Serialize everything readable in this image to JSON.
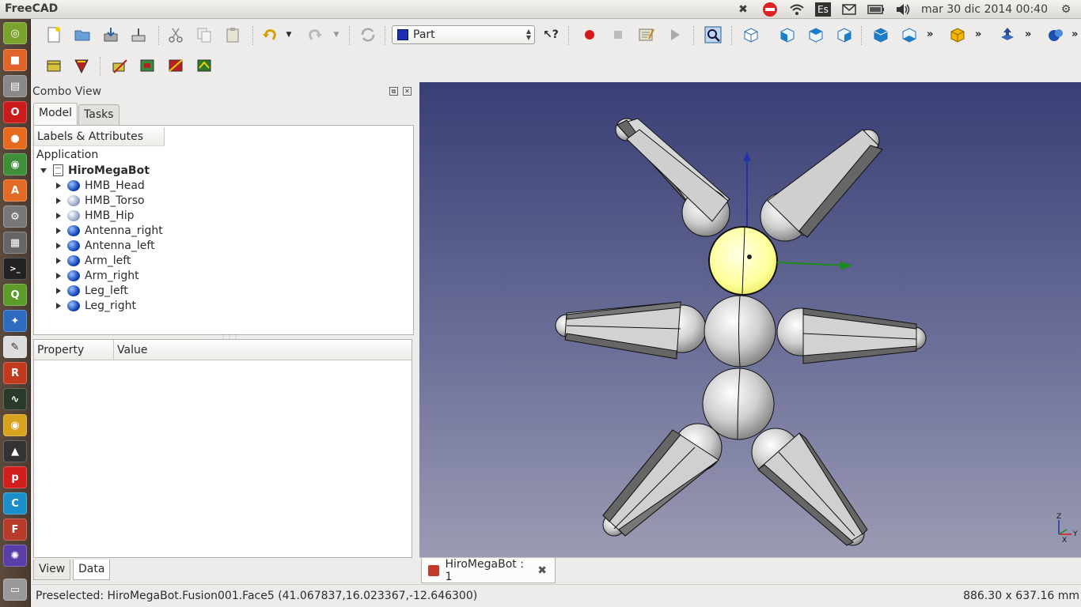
{
  "topbar": {
    "app_name": "FreeCAD",
    "clock": "mar 30 dic 2014 00:40",
    "keyboard_layout": "Es",
    "indicators": [
      "dropbox-icon",
      "stop-sign-icon",
      "wifi-icon",
      "keyboard-layout-icon",
      "mail-icon",
      "battery-icon",
      "volume-icon",
      "gear-icon"
    ]
  },
  "launcher": {
    "items": [
      "dash-home",
      "files",
      "file-manager",
      "opera",
      "firefox",
      "chrome",
      "software-center",
      "system-settings",
      "calculator",
      "terminal",
      "qgis",
      "inkscape-like",
      "text-editor",
      "r-app",
      "system-monitor",
      "blender",
      "inkscape",
      "p-app",
      "c-app",
      "freecad",
      "gnome-app",
      "trash"
    ]
  },
  "toolbar": {
    "workbench": "Part"
  },
  "combo_view": {
    "title": "Combo View",
    "tabs": [
      {
        "label": "Model",
        "active": true
      },
      {
        "label": "Tasks",
        "active": false
      }
    ],
    "tree_header": "Labels & Attributes",
    "tree_root": "Application",
    "document": "HiroMegaBot",
    "items": [
      {
        "label": "HMB_Head",
        "visible": true
      },
      {
        "label": "HMB_Torso",
        "visible": false
      },
      {
        "label": "HMB_Hip",
        "visible": false
      },
      {
        "label": "Antenna_right",
        "visible": true
      },
      {
        "label": "Antenna_left",
        "visible": true
      },
      {
        "label": "Arm_left",
        "visible": true
      },
      {
        "label": "Arm_right",
        "visible": true
      },
      {
        "label": "Leg_left",
        "visible": true
      },
      {
        "label": "Leg_right",
        "visible": true
      }
    ],
    "property_headers": {
      "property": "Property",
      "value": "Value"
    },
    "bottom_tabs": [
      {
        "label": "View",
        "active": false
      },
      {
        "label": "Data",
        "active": true
      }
    ]
  },
  "document_tab": {
    "label": "HiroMegaBot : 1"
  },
  "status": {
    "message": "Preselected: HiroMegaBot.Fusion001.Face5 (41.067837,16.023367,-12.646300)",
    "dimensions": "886.30 x 637.16 mm"
  },
  "axis_cross": {
    "x": "X",
    "y": "Y",
    "z": "Z"
  }
}
